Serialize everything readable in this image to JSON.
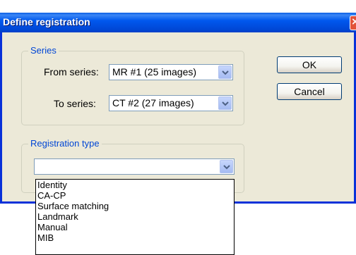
{
  "window": {
    "title": "Define registration",
    "close_symbol": "×"
  },
  "series_group": {
    "label": "Series",
    "from_label": "From series:",
    "from_value": "MR #1 (25 images)",
    "to_label": "To series:",
    "to_value": "CT #2 (27 images)"
  },
  "registration_group": {
    "label": "Registration type",
    "selected_value": "",
    "options": [
      "Identity",
      "CA-CP",
      "Surface matching",
      "Landmark",
      "Manual",
      "MIB"
    ]
  },
  "buttons": {
    "ok": "OK",
    "cancel": "Cancel"
  }
}
